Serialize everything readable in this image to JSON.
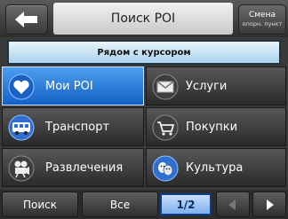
{
  "header": {
    "title": "Поиск POI",
    "switch_label_line1": "Смена",
    "switch_label_line2": "опорн. пункт"
  },
  "near_cursor_label": "Рядом с курсором",
  "categories": [
    {
      "label": "Мои POI",
      "icon": "heart-icon",
      "selected": true
    },
    {
      "label": "Услуги",
      "icon": "envelope-icon",
      "selected": false
    },
    {
      "label": "Транспорт",
      "icon": "bus-icon",
      "selected": false
    },
    {
      "label": "Покупки",
      "icon": "shopping-cart-icon",
      "selected": false
    },
    {
      "label": "Развлечения",
      "icon": "film-camera-icon",
      "selected": false
    },
    {
      "label": "Культура",
      "icon": "theater-masks-icon",
      "selected": false
    }
  ],
  "footer": {
    "search_label": "Поиск",
    "all_label": "Все",
    "page_indicator": "1/2"
  },
  "colors": {
    "selected_cell": "#1e6fd8",
    "near_bar": "#bfe0f4",
    "page_indicator": "#9cc4f4"
  }
}
